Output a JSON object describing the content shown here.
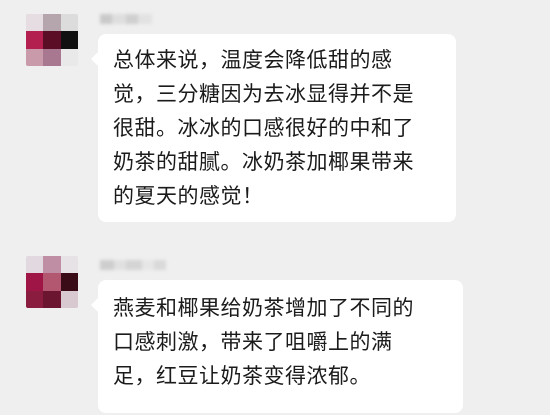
{
  "messages": [
    {
      "avatar_colors": [
        "#e6dde2",
        "#b5a6ad",
        "#dcdcdc",
        "#b3204f",
        "#5a0d25",
        "#111111",
        "#c99aa9",
        "#a87890",
        "#e9e9e9"
      ],
      "lines": [
        "总体来说，温度会降低甜的感",
        "觉，三分糖因为去冰显得并不是",
        "很甜。冰冰的口感很好的中和了",
        "奶茶的甜腻。冰奶茶加椰果带来",
        "的夏天的感觉！"
      ]
    },
    {
      "avatar_colors": [
        "#e2d8df",
        "#c08ea4",
        "#e7e2e5",
        "#9f1545",
        "#b2576f",
        "#3a0c18",
        "#8a1c40",
        "#6c1530",
        "#d7c9cf"
      ],
      "lines": [
        "燕麦和椰果给奶茶增加了不同的",
        "口感刺激，带来了咀嚼上的满",
        "足，红豆让奶茶变得浓郁。"
      ]
    }
  ],
  "colors": {
    "background": "#efefef",
    "bubble": "#ffffff",
    "text": "#1b1b1b"
  }
}
